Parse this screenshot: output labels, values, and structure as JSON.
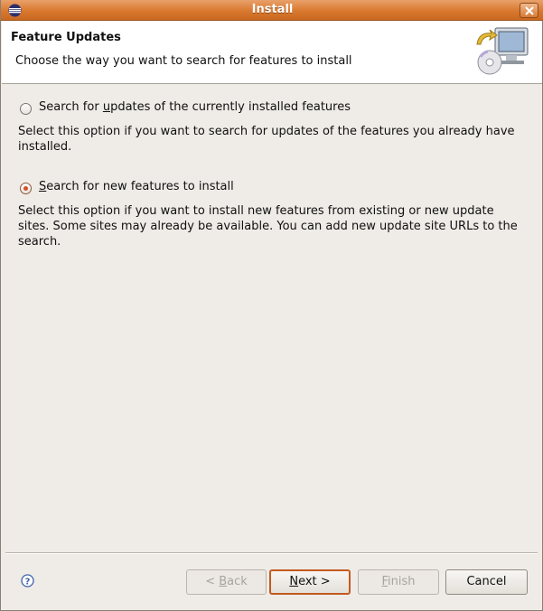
{
  "window": {
    "title": "Install"
  },
  "header": {
    "title": "Feature Updates",
    "description": "Choose the way you want to search for features to install"
  },
  "options": [
    {
      "label_pre": "Search for ",
      "label_underline": "u",
      "label_post": "pdates of the currently installed features",
      "description": "Select this option if you want to search for updates of the features you already have installed.",
      "selected": false
    },
    {
      "label_pre": "",
      "label_underline": "S",
      "label_post": "earch for new features to install",
      "description": "Select this option if you want to install new features from existing or new update sites. Some sites may already be available. You can add new update site URLs to the search.",
      "selected": true
    }
  ],
  "buttons": {
    "back": {
      "pre": "< ",
      "underline": "B",
      "post": "ack",
      "enabled": false
    },
    "next": {
      "pre": "",
      "underline": "N",
      "post": "ext >",
      "enabled": true
    },
    "finish": {
      "pre": "",
      "underline": "F",
      "post": "inish",
      "enabled": false
    },
    "cancel": {
      "label": "Cancel",
      "enabled": true
    }
  },
  "icons": {
    "app": "eclipse-icon",
    "close": "close-icon",
    "header": "computer-update-icon",
    "help": "help-icon"
  },
  "colors": {
    "titlebar": "#d9782f",
    "default_button_border": "#c45a1e",
    "radio_checked": "#d6502a"
  }
}
